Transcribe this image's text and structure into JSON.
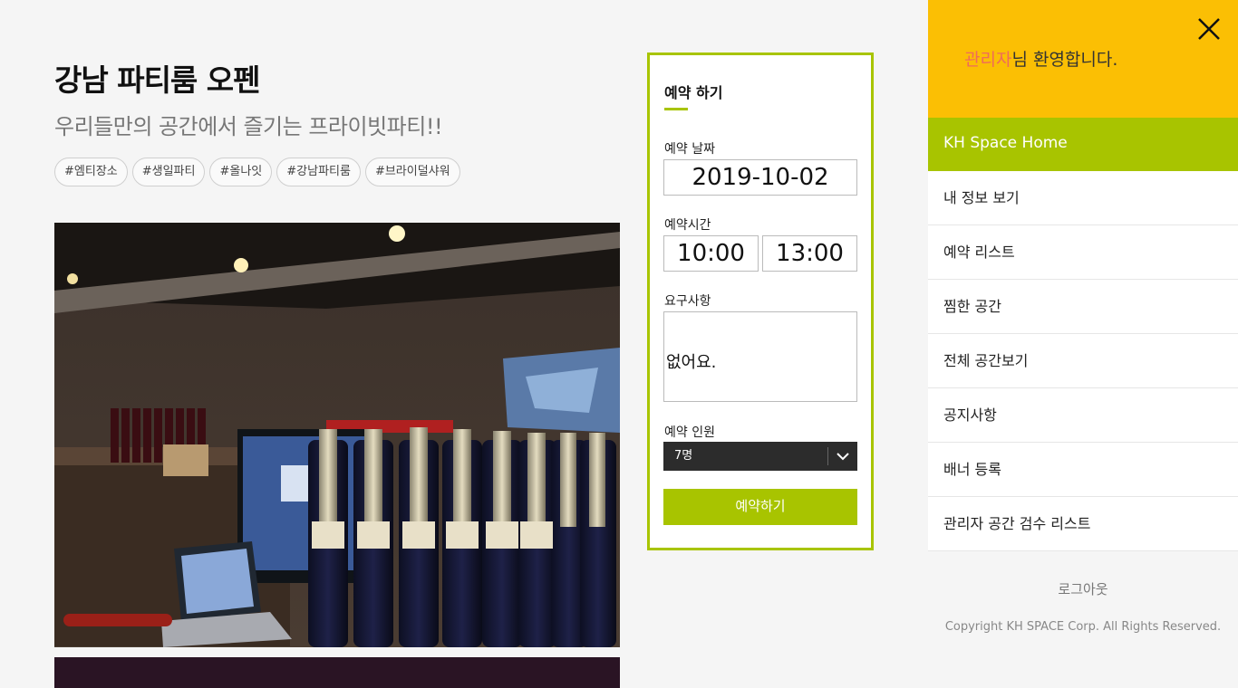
{
  "space": {
    "title": "강남 파티룸 오펜",
    "subtitle": "우리들만의 공간에서 즐기는 프라이빗파티!!",
    "tags": [
      "#엠티장소",
      "#생일파티",
      "#올나잇",
      "#강남파티룸",
      "#브라이덜샤워"
    ]
  },
  "reservation": {
    "heading": "예약 하기",
    "date_label": "예약 날짜",
    "date_value": "2019-10-02",
    "time_label": "예약시간",
    "time_start": "10:00",
    "time_end": "13:00",
    "request_label": "요구사항",
    "request_value": "없어요.",
    "people_label": "예약 인원",
    "people_value": "7명",
    "submit_label": "예약하기"
  },
  "side_menu": {
    "welcome_user": "관리자",
    "welcome_suffix": "님 환영합니다.",
    "home_label": "KH Space Home",
    "items": [
      "내 정보 보기",
      "예약 리스트",
      "찜한 공간",
      "전체 공간보기",
      "공지사항",
      "배너 등록",
      "관리자 공간 검수 리스트"
    ],
    "logout_label": "로그아웃",
    "copyright": "Copyright KH SPACE Corp. All Rights Reserved."
  },
  "colors": {
    "accent_green": "#a8c400",
    "header_yellow": "#fbbf04",
    "admin_red": "#ef6b5a"
  },
  "icons": {
    "close": "close-icon",
    "select_arrow": "chevron-down-icon"
  }
}
